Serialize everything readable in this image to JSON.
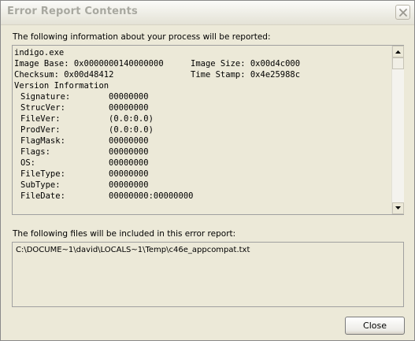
{
  "window": {
    "title": "Error Report Contents"
  },
  "report": {
    "intro_label": "The following information about your process will be reported:",
    "lines": {
      "exe": "indigo.exe",
      "image_base_label": "Image Base: 0x0000000140000000",
      "image_size_label": "Image Size: 0x00d4c000",
      "checksum_label": "Checksum: 0x00d48412",
      "timestamp_label": "Time Stamp: 0x4e25988c",
      "version_header": "Version Information"
    },
    "version_fields": [
      {
        "key": "Signature:",
        "value": "00000000"
      },
      {
        "key": "StrucVer:",
        "value": "00000000"
      },
      {
        "key": "FileVer:",
        "value": "(0.0:0.0)"
      },
      {
        "key": "ProdVer:",
        "value": "(0.0:0.0)"
      },
      {
        "key": "FlagMask:",
        "value": "00000000"
      },
      {
        "key": "Flags:",
        "value": "00000000"
      },
      {
        "key": "OS:",
        "value": "00000000"
      },
      {
        "key": "FileType:",
        "value": "00000000"
      },
      {
        "key": "SubType:",
        "value": "00000000"
      },
      {
        "key": "FileDate:",
        "value": "00000000:00000000"
      }
    ]
  },
  "files": {
    "label": "The following files will be included in this error report:",
    "paths": [
      "C:\\DOCUME~1\\david\\LOCALS~1\\Temp\\c46e_appcompat.txt"
    ]
  },
  "buttons": {
    "close_label": "Close"
  },
  "icons": {
    "window_close": "close-x-icon",
    "scroll_up": "arrow-up-icon",
    "scroll_down": "arrow-down-icon"
  },
  "colors": {
    "dialog_bg": "#ece9d8",
    "title_text": "#a8a8a0",
    "border": "#7f9db9"
  }
}
